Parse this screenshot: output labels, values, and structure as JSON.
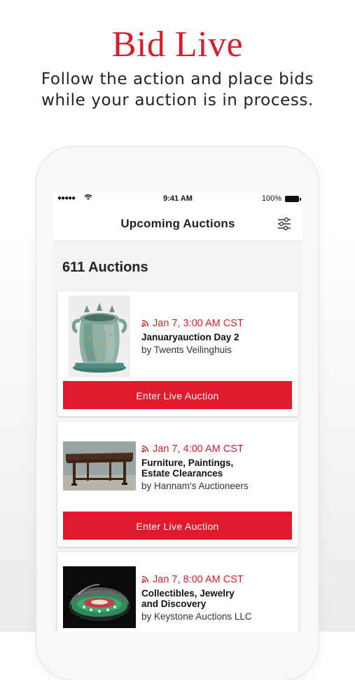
{
  "hero": {
    "headline": "Bid Live",
    "subline_1": "Follow the action and place bids",
    "subline_2": "while your auction is in process."
  },
  "status_bar": {
    "signal": "●●●●●",
    "time": "9:41 AM",
    "battery": "100%"
  },
  "nav": {
    "title": "Upcoming Auctions",
    "filter_icon": "sliders-icon"
  },
  "listing": {
    "count": "611 Auctions"
  },
  "auctions": [
    {
      "date": "Jan 7, 3:00 AM CST",
      "title_1": "Januaryauction Day 2",
      "title_2": "",
      "by": "by Twents Veilinghuis",
      "button": "Enter Live Auction"
    },
    {
      "date": "Jan 7, 4:00 AM CST",
      "title_1": "Furniture, Paintings,",
      "title_2": "Estate Clearances",
      "by": "by Hannam's Auctioneers",
      "button": "Enter Live Auction"
    },
    {
      "date": "Jan 7, 8:00 AM CST",
      "title_1": "Collectibles, Jewelry",
      "title_2": "and Discovery",
      "by": "by Keystone Auctions LLC",
      "button": ""
    }
  ],
  "colors": {
    "accent": "#d71f2c",
    "button": "#e0192c"
  }
}
